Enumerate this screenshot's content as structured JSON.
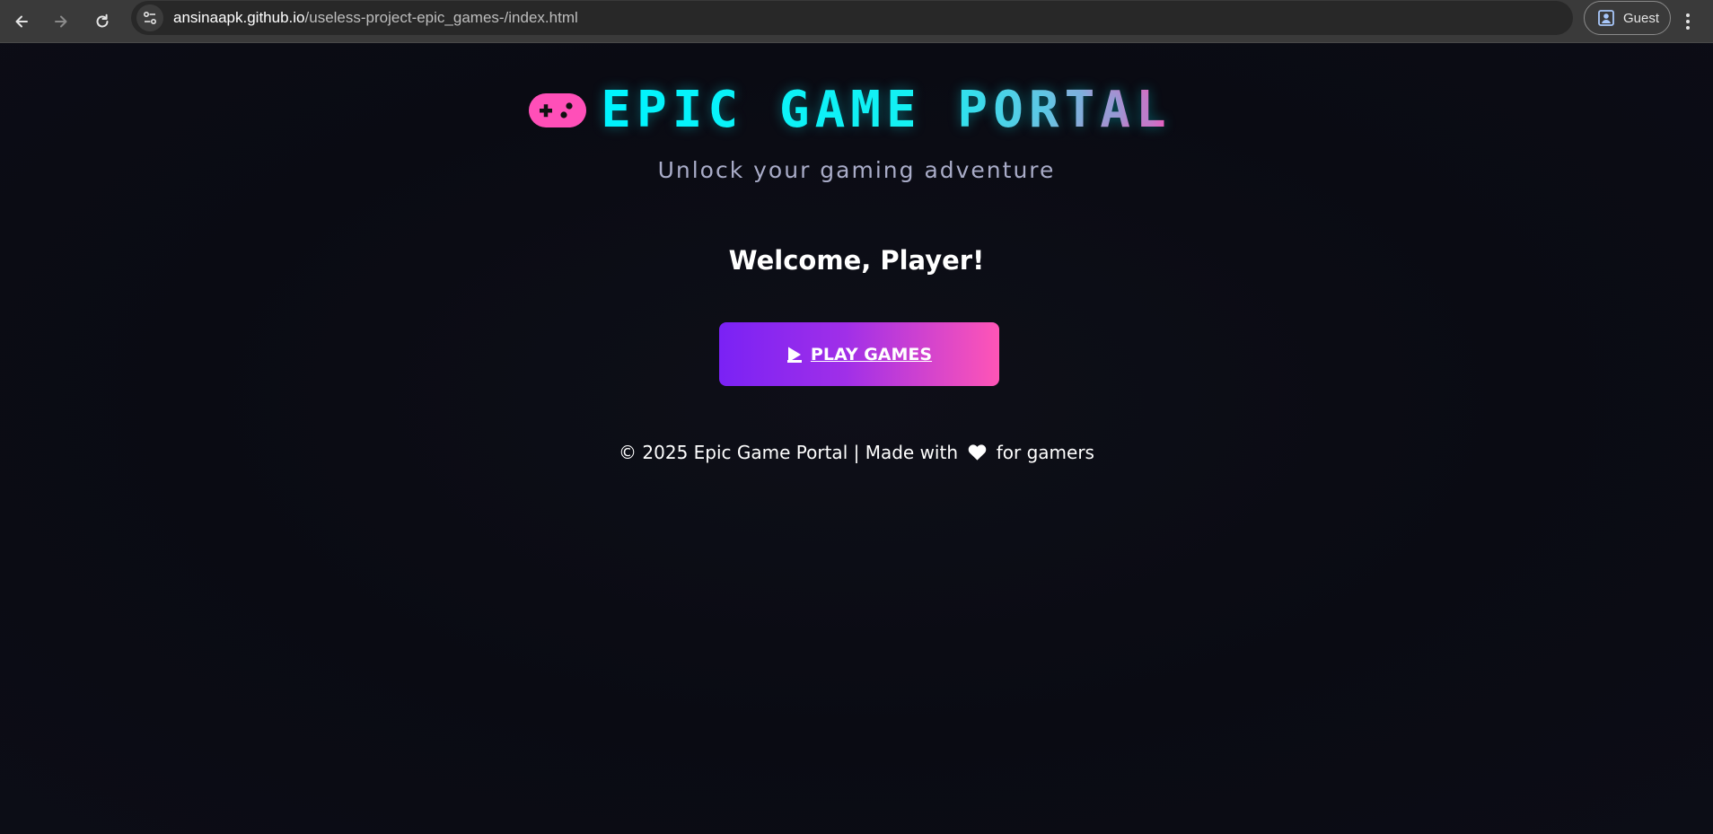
{
  "browser": {
    "url_host": "ansinaapk.github.io",
    "url_path": "/useless-project-epic_games-/index.html",
    "profile_label": "Guest"
  },
  "header": {
    "title": "EPIC GAME PORTAL",
    "subtitle": "Unlock your gaming adventure"
  },
  "main": {
    "welcome": "Welcome, Player!",
    "play_button_label": "PLAY GAMES"
  },
  "footer": {
    "text_before": "© 2025 Epic Game Portal | Made with",
    "text_after": "for gamers"
  },
  "colors": {
    "background": "#0b0c14",
    "accent_cyan": "#00f5ff",
    "accent_pink": "#ff4fb8",
    "accent_purple": "#7a22f5"
  },
  "icons": {
    "logo": "gamepad-icon",
    "play": "play-icon",
    "footer": "heart-icon"
  }
}
